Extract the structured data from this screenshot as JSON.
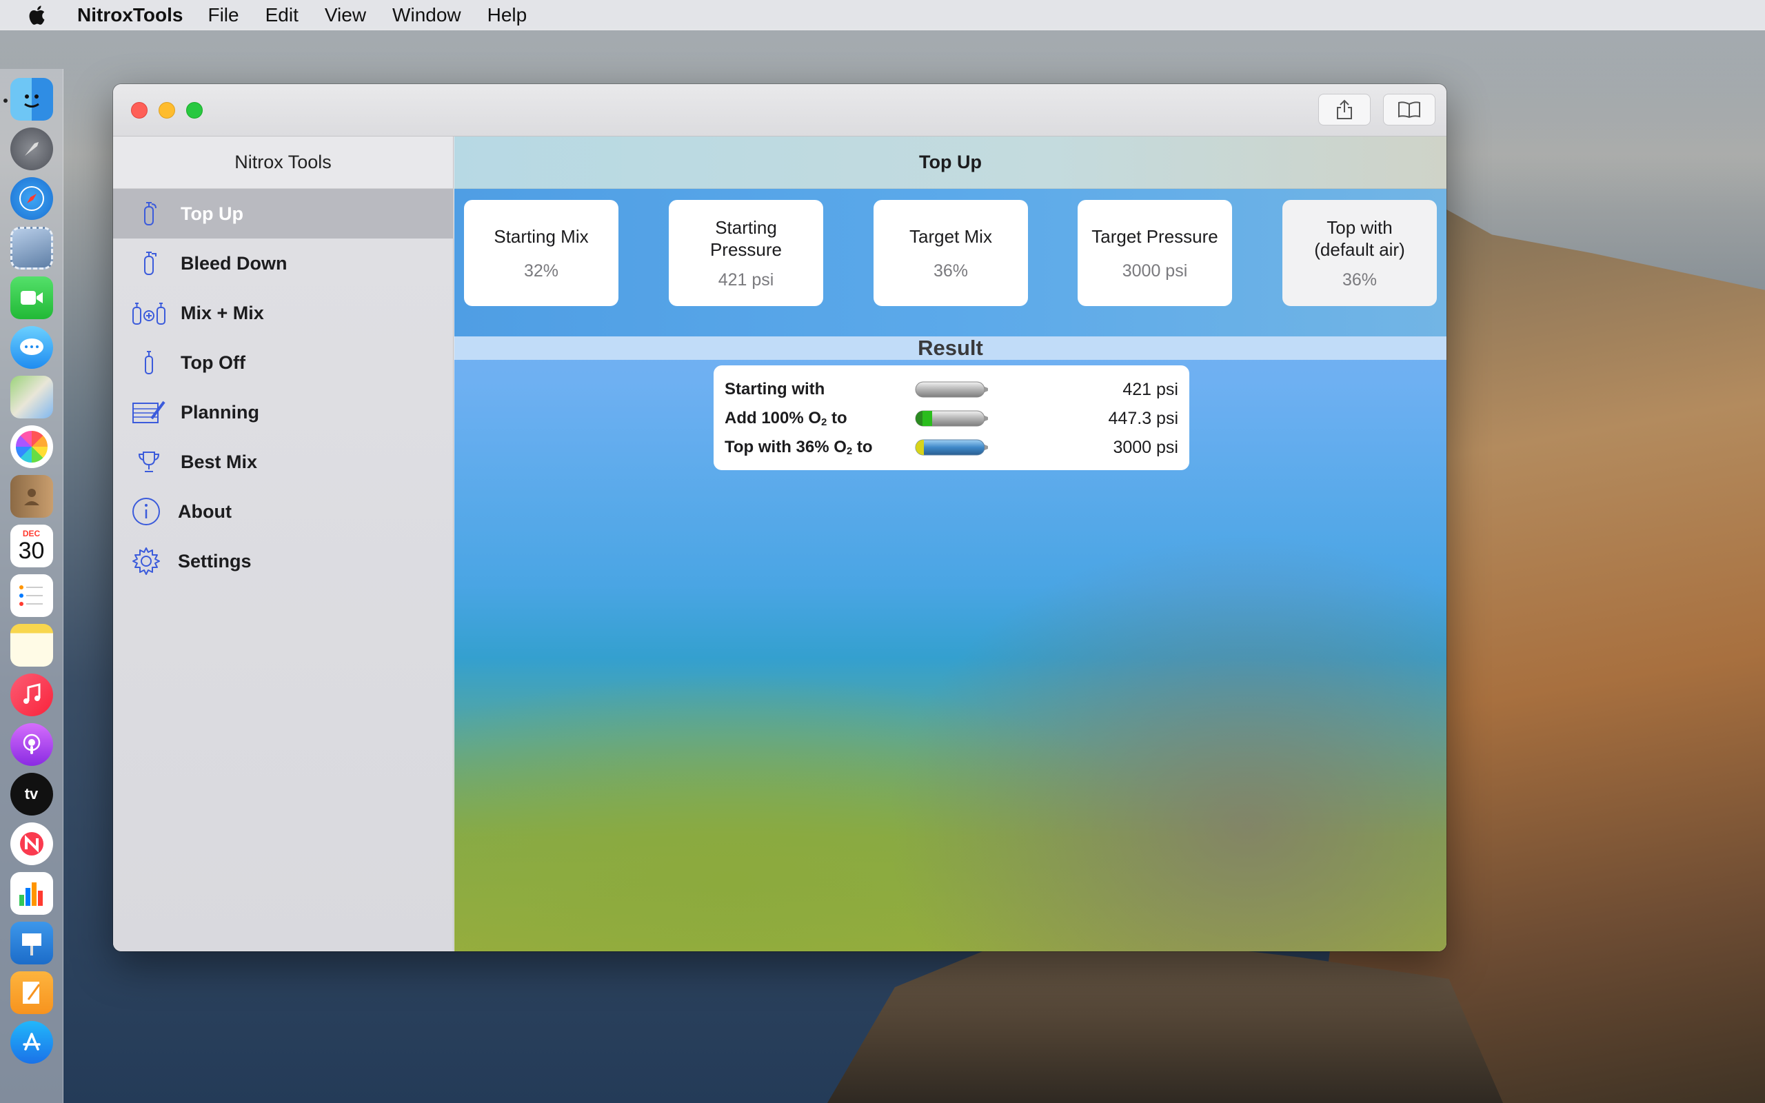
{
  "menubar": {
    "app_name": "NitroxTools",
    "menus": [
      "File",
      "Edit",
      "View",
      "Window",
      "Help"
    ]
  },
  "dock": {
    "calendar_month": "DEC",
    "calendar_day": "30",
    "tv_label": "tv"
  },
  "sidebar": {
    "title": "Nitrox Tools",
    "items": [
      {
        "label": "Top Up",
        "icon": "tank-icon"
      },
      {
        "label": "Bleed Down",
        "icon": "tank-bleed-icon"
      },
      {
        "label": "Mix + Mix",
        "icon": "mix-tanks-icon"
      },
      {
        "label": "Top Off",
        "icon": "tank-small-icon"
      },
      {
        "label": "Planning",
        "icon": "planning-icon"
      },
      {
        "label": "Best Mix",
        "icon": "trophy-icon"
      },
      {
        "label": "About",
        "icon": "info-icon"
      },
      {
        "label": "Settings",
        "icon": "gear-icon"
      }
    ],
    "selected_index": 0
  },
  "main": {
    "title": "Top Up",
    "cards": [
      {
        "title": "Starting Mix",
        "value": "32%"
      },
      {
        "title": "Starting Pressure",
        "value": "421 psi"
      },
      {
        "title": "Target Mix",
        "value": "36%"
      },
      {
        "title": "Target Pressure",
        "value": "3000 psi"
      },
      {
        "title": "Top with (default air)",
        "value": "36%"
      }
    ],
    "result_title": "Result",
    "results": [
      {
        "label": "Starting with",
        "value": "421 psi"
      },
      {
        "label_pre": "Add 100% O",
        "label_sub": "2",
        "label_post": " to",
        "value": "447.3 psi"
      },
      {
        "label_pre": "Top with 36% O",
        "label_sub": "2",
        "label_post": " to",
        "value": "3000 psi"
      }
    ]
  },
  "colors": {
    "accent_icon": "#3b5bdb",
    "selected_row": "#b9bac0",
    "o2_fill": "#2bbd1d",
    "mix_fill_yellow": "#d8d31a",
    "mix_fill_blue": "#3f88c8"
  }
}
